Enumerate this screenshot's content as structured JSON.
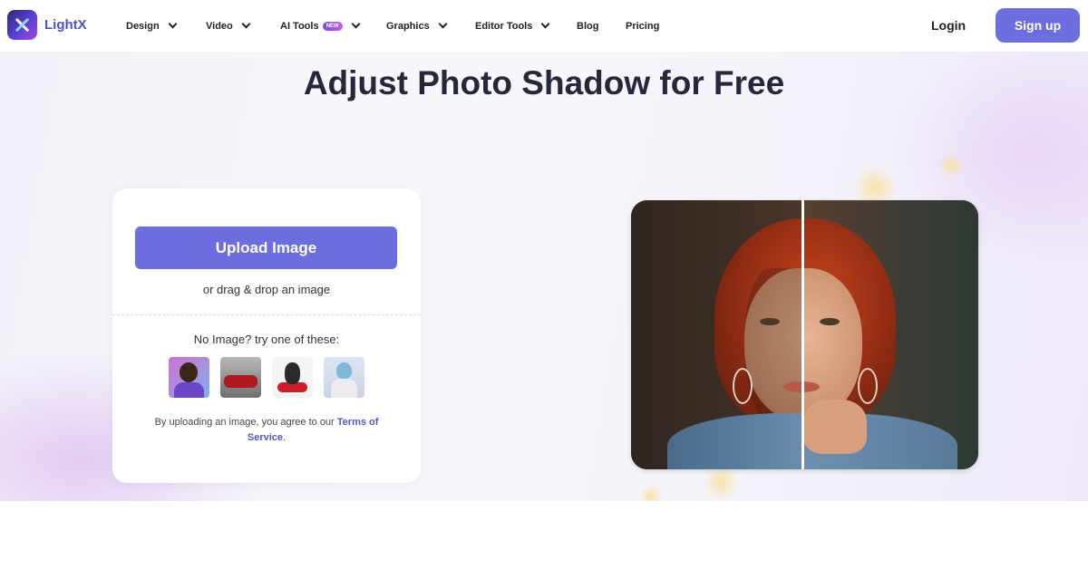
{
  "nav": {
    "brand": "LightX",
    "menu": [
      {
        "label": "Design",
        "has_dropdown": true
      },
      {
        "label": "Video",
        "has_dropdown": true
      },
      {
        "label": "AI Tools",
        "badge": "NEW",
        "has_dropdown": true
      },
      {
        "label": "Graphics",
        "has_dropdown": true
      },
      {
        "label": "Editor Tools",
        "has_dropdown": true
      },
      {
        "label": "Blog",
        "has_dropdown": false
      },
      {
        "label": "Pricing",
        "has_dropdown": false
      }
    ],
    "login": "Login",
    "signup": "Sign up"
  },
  "hero": {
    "title": "Adjust Photo Shadow for Free",
    "upload_button": "Upload Image",
    "drag_text": "or drag & drop an image",
    "sample_prompt": "No Image? try one of these:",
    "samples": [
      "man-portrait",
      "red-car",
      "french-bulldog",
      "woman-winter-hat"
    ],
    "terms_prefix": "By uploading an image, you agree to our ",
    "terms_link": "Terms of Service",
    "terms_suffix": "."
  },
  "colors": {
    "accent": "#6c6ee0",
    "brand_text": "#4c52c9",
    "title": "#25283a"
  }
}
